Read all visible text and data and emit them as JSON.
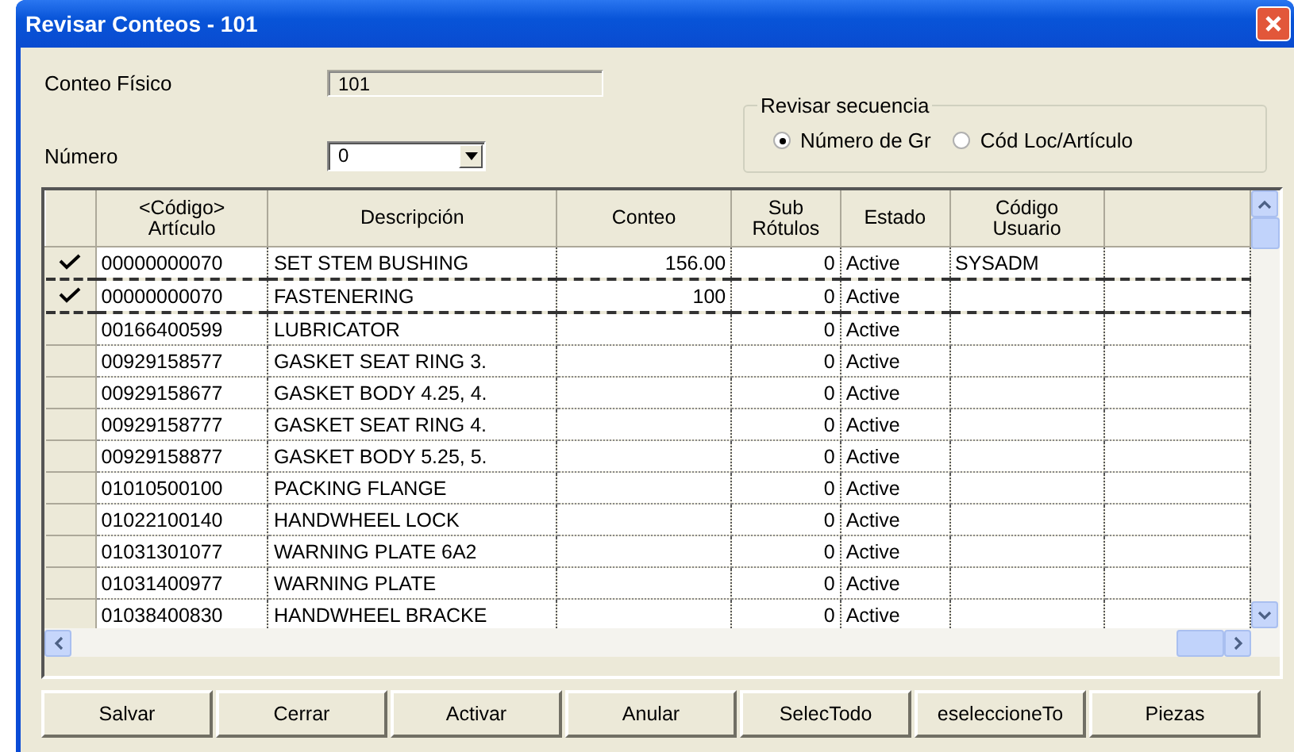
{
  "window": {
    "title": "Revisar Conteos - 101"
  },
  "conteo_fisico": {
    "label": "Conteo Físico",
    "value": "101"
  },
  "numero": {
    "label": "Número",
    "value": "0"
  },
  "revisar_secuencia": {
    "title": "Revisar secuencia",
    "options": [
      {
        "label": "Número de Gr",
        "selected": true
      },
      {
        "label": "Cód Loc/Artículo",
        "selected": false
      }
    ]
  },
  "table": {
    "columns": [
      "<Código>\nArtículo",
      "Descripción",
      "Conteo",
      "Sub\nRótulos",
      "Estado",
      "Código\nUsuario"
    ],
    "rows": [
      {
        "checked": true,
        "selected": false,
        "cells": [
          "00000000070",
          "SET STEM BUSHING",
          "156.00",
          "0",
          "Active",
          "SYSADM"
        ]
      },
      {
        "checked": true,
        "selected": true,
        "cells": [
          "00000000070",
          "FASTENERING",
          "100",
          "0",
          "Active",
          ""
        ]
      },
      {
        "checked": false,
        "selected": false,
        "cells": [
          "00166400599",
          "LUBRICATOR",
          "",
          "0",
          "Active",
          ""
        ]
      },
      {
        "checked": false,
        "selected": false,
        "cells": [
          "00929158577",
          "GASKET SEAT RING 3.",
          "",
          "0",
          "Active",
          ""
        ]
      },
      {
        "checked": false,
        "selected": false,
        "cells": [
          "00929158677",
          "GASKET BODY 4.25, 4.",
          "",
          "0",
          "Active",
          ""
        ]
      },
      {
        "checked": false,
        "selected": false,
        "cells": [
          "00929158777",
          "GASKET SEAT RING 4.",
          "",
          "0",
          "Active",
          ""
        ]
      },
      {
        "checked": false,
        "selected": false,
        "cells": [
          "00929158877",
          "GASKET BODY 5.25, 5.",
          "",
          "0",
          "Active",
          ""
        ]
      },
      {
        "checked": false,
        "selected": false,
        "cells": [
          "01010500100",
          "PACKING FLANGE",
          "",
          "0",
          "Active",
          ""
        ]
      },
      {
        "checked": false,
        "selected": false,
        "cells": [
          "01022100140",
          "HANDWHEEL LOCK",
          "",
          "0",
          "Active",
          ""
        ]
      },
      {
        "checked": false,
        "selected": false,
        "cells": [
          "01031301077",
          "WARNING PLATE 6A2",
          "",
          "0",
          "Active",
          ""
        ]
      },
      {
        "checked": false,
        "selected": false,
        "cells": [
          "01031400977",
          "WARNING PLATE",
          "",
          "0",
          "Active",
          ""
        ]
      },
      {
        "checked": false,
        "selected": false,
        "cells": [
          "01038400830",
          "HANDWHEEL BRACKE",
          "",
          "0",
          "Active",
          ""
        ]
      }
    ]
  },
  "buttons": [
    "Salvar",
    "Cerrar",
    "Activar",
    "Anular",
    "SelecTodo",
    "eseleccioneTo",
    "Piezas"
  ]
}
